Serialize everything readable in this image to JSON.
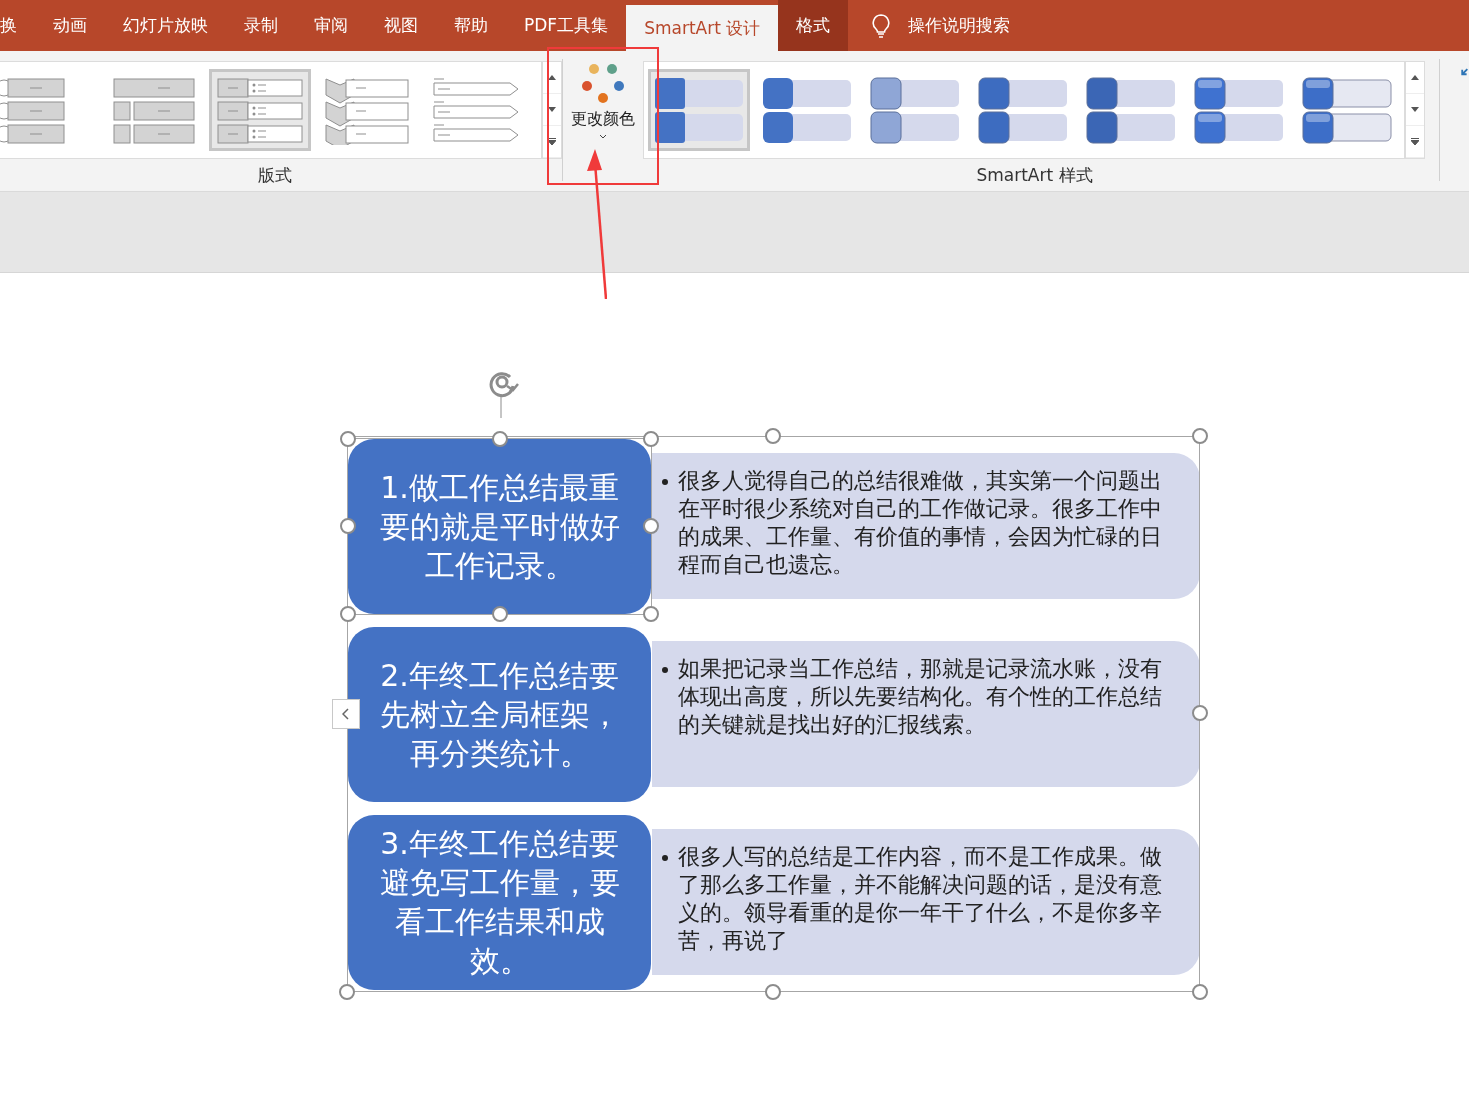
{
  "tabs": [
    {
      "label": "换",
      "selected": false,
      "kind": "normal"
    },
    {
      "label": "动画",
      "selected": false,
      "kind": "normal"
    },
    {
      "label": "幻灯片放映",
      "selected": false,
      "kind": "normal"
    },
    {
      "label": "录制",
      "selected": false,
      "kind": "normal"
    },
    {
      "label": "审阅",
      "selected": false,
      "kind": "normal"
    },
    {
      "label": "视图",
      "selected": false,
      "kind": "normal"
    },
    {
      "label": "帮助",
      "selected": false,
      "kind": "normal"
    },
    {
      "label": "PDF工具集",
      "selected": false,
      "kind": "normal"
    },
    {
      "label": "SmartArt 设计",
      "selected": true,
      "kind": "contextual"
    },
    {
      "label": "格式",
      "selected": false,
      "kind": "contextual"
    }
  ],
  "search": {
    "label": "操作说明搜索"
  },
  "ribbon": {
    "layouts": {
      "label": "版式",
      "items": [
        {
          "selected": false
        },
        {
          "selected": false
        },
        {
          "selected": true
        },
        {
          "selected": false
        },
        {
          "selected": false
        }
      ]
    },
    "change_colors": {
      "label": "更改颜色"
    },
    "styles": {
      "label": "SmartArt 样式",
      "items": [
        {
          "selected": true
        },
        {
          "selected": false
        },
        {
          "selected": false
        },
        {
          "selected": false
        },
        {
          "selected": false
        },
        {
          "selected": false
        },
        {
          "selected": false
        }
      ]
    }
  },
  "smartart": {
    "rows": [
      {
        "title": "1.做工作总结最重要的就是平时做好工作记录。",
        "text": "很多人觉得自己的总结很难做，其实第一个问题出在平时很少系统对自己的工作做记录。很多工作中的成果、工作量、有价值的事情，会因为忙碌的日程而自己也遗忘。",
        "selected": true
      },
      {
        "title": "2.年终工作总结要先树立全局框架，再分类统计。",
        "text": "如果把记录当工作总结，那就是记录流水账，没有体现出高度，所以先要结构化。有个性的工作总结的关键就是找出好的汇报线索。",
        "selected": false
      },
      {
        "title": "3.年终工作总结要避免写工作量，要看工作结果和成效。",
        "text": "很多人写的总结是工作内容，而不是工作成果。做了那么多工作量，并不能解决问题的话，是没有意义的。领导看重的是你一年干了什么，不是你多辛苦，再说了",
        "selected": false
      }
    ]
  }
}
